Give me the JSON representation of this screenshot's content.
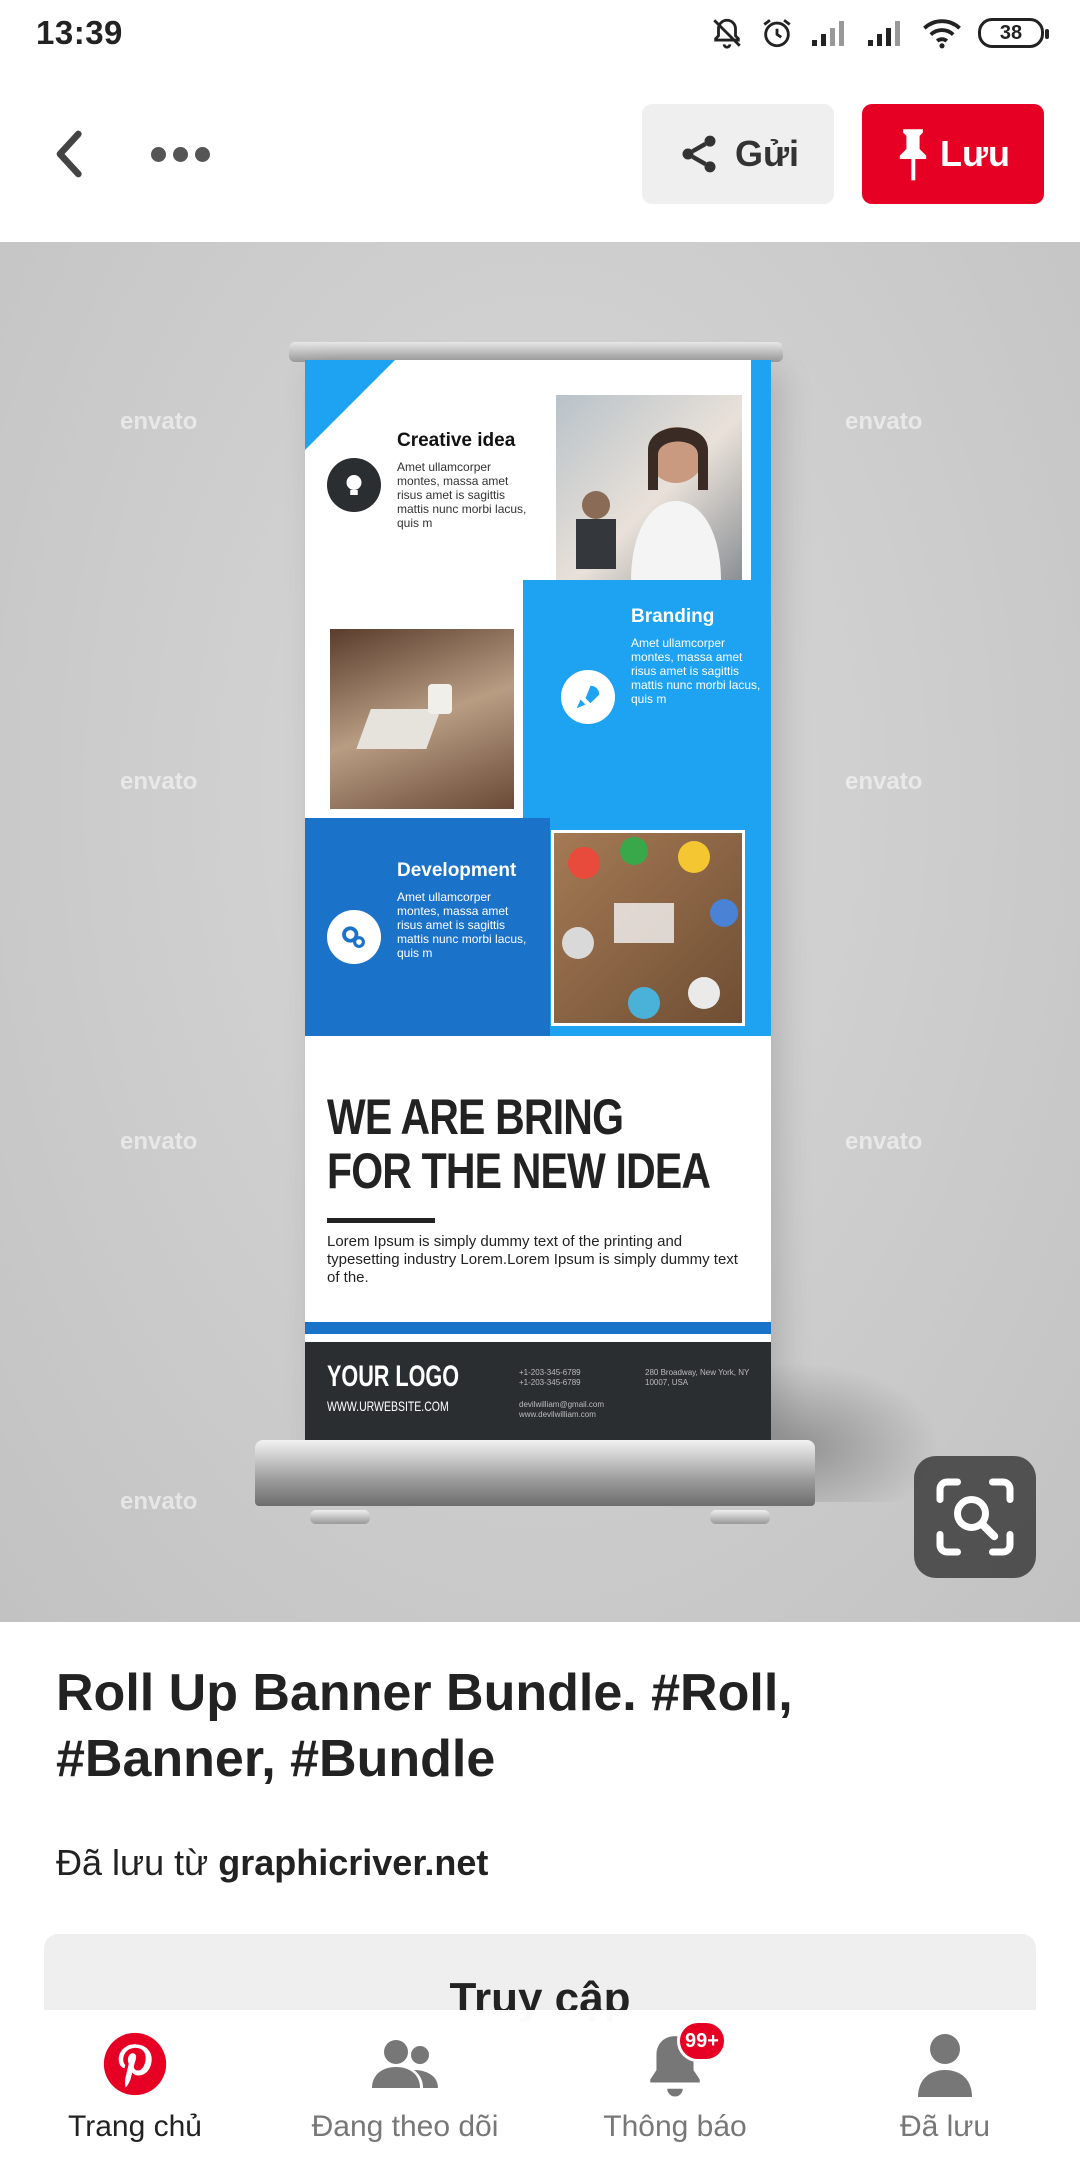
{
  "status_bar": {
    "time": "13:39",
    "battery": "38",
    "icons": [
      "mute-icon",
      "alarm-icon",
      "signal-icon",
      "signal-icon",
      "wifi-icon",
      "battery-icon"
    ]
  },
  "toolbar": {
    "send_label": "Gửi",
    "save_label": "Lưu",
    "colors": {
      "save_bg": "#e60023",
      "send_bg": "#efefef"
    }
  },
  "banner": {
    "sections": [
      {
        "title": "Creative idea",
        "body": "Amet ullamcorper montes, massa amet risus amet is sagittis mattis nunc morbi lacus, quis m"
      },
      {
        "title": "Branding",
        "body": "Amet ullamcorper montes, massa amet risus amet is sagittis mattis nunc morbi lacus, quis m"
      },
      {
        "title": "Development",
        "body": "Amet ullamcorper montes, massa amet risus amet is sagittis mattis nunc morbi lacus, quis m"
      }
    ],
    "headline_line1": "WE ARE BRING",
    "headline_line2": "FOR THE NEW IDEA",
    "lorem": "Lorem Ipsum is simply dummy text of the printing and typesetting industry Lorem.Lorem Ipsum is simply dummy text of the.",
    "logo": "YOUR LOGO",
    "website": "WWW.URWEBSITE.COM",
    "phone": "+1-203-345-6789\n+1-203-345-6789",
    "address": "280 Broadway, New York, NY 10007, USA",
    "email": "devilwilliam@gmail.com\nwww.devilwilliam.com",
    "watermark": "envato",
    "colors": {
      "light_blue": "#1ea3f2",
      "dark_blue": "#1b72c9",
      "footer": "#2b2e31"
    }
  },
  "pin": {
    "title": "Roll Up Banner Bundle. #Roll, #Banner, #Bundle",
    "source_prefix": "Đã lưu từ ",
    "source_domain": "graphicriver.net",
    "visit_label": "Truy cập"
  },
  "bottom_nav": {
    "items": [
      {
        "label": "Trang chủ",
        "icon": "pinterest-icon"
      },
      {
        "label": "Đang theo dõi",
        "icon": "people-icon"
      },
      {
        "label": "Thông báo",
        "icon": "bell-icon",
        "badge": "99+"
      },
      {
        "label": "Đã lưu",
        "icon": "person-icon"
      }
    ]
  }
}
